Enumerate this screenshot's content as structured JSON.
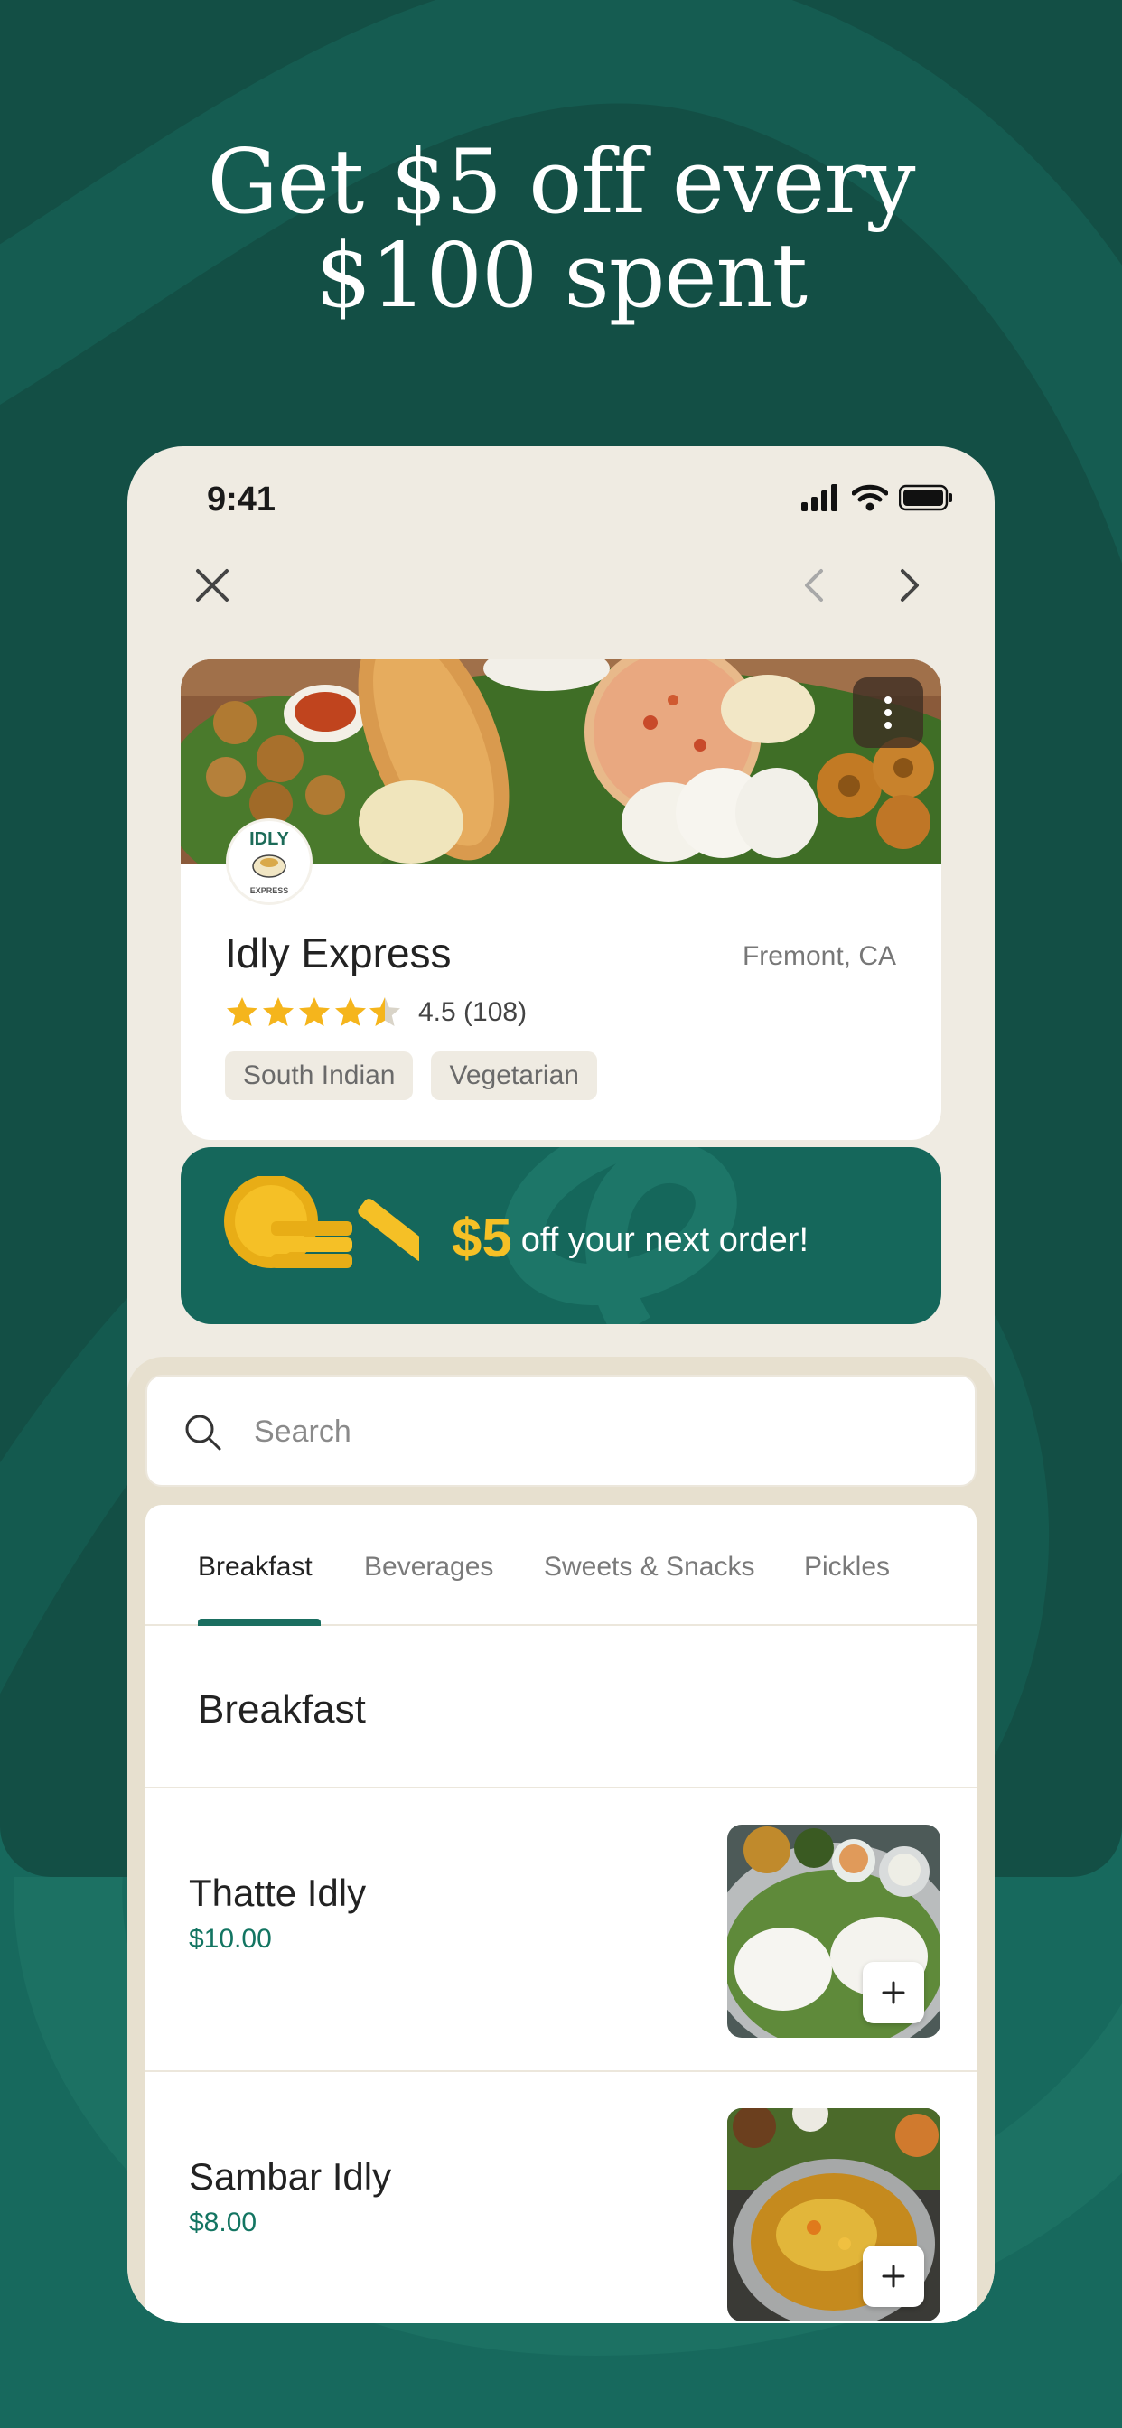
{
  "headline": {
    "line1": "Get $5 off every",
    "line2": "$100 spent"
  },
  "status_bar": {
    "time": "9:41"
  },
  "restaurant": {
    "logo_text": "IDLY",
    "logo_subtext": "EXPRESS",
    "name": "Idly Express",
    "location": "Fremont, CA",
    "rating": 4.5,
    "rating_text": "4.5 (108)",
    "tags": [
      "South Indian",
      "Vegetarian"
    ]
  },
  "promo": {
    "amount": "$5",
    "text": "off your next order!"
  },
  "search": {
    "placeholder": "Search"
  },
  "tabs": [
    {
      "label": "Breakfast",
      "active": true
    },
    {
      "label": "Beverages",
      "active": false
    },
    {
      "label": "Sweets & Snacks",
      "active": false
    },
    {
      "label": "Pickles",
      "active": false
    }
  ],
  "section": {
    "title": "Breakfast"
  },
  "items": [
    {
      "name": "Thatte Idly",
      "price": "$10.00"
    },
    {
      "name": "Sambar Idly",
      "price": "$8.00"
    }
  ],
  "colors": {
    "background_dark": "#134f45",
    "background": "#17695d",
    "accent": "#1a6e60",
    "gold": "#f5c026",
    "card_bg": "#efebe2"
  }
}
